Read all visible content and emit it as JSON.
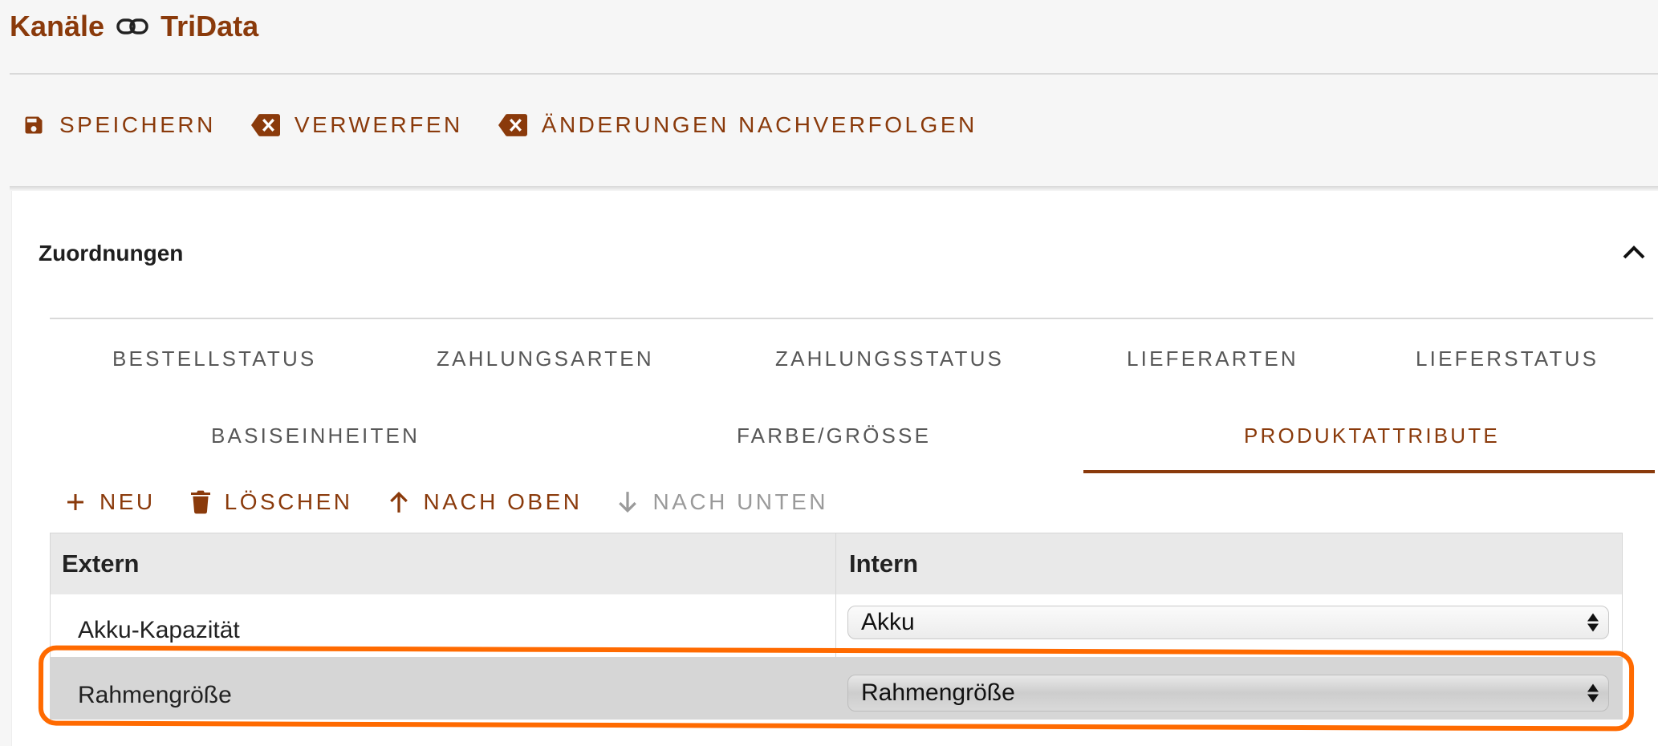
{
  "header": {
    "title_left": "Kanäle",
    "title_right": "TriData",
    "link_icon": "link-icon"
  },
  "toolbar": {
    "save": "SPEICHERN",
    "discard": "VERWERFEN",
    "track": "ÄNDERUNGEN NACHVERFOLGEN"
  },
  "section": {
    "title": "Zuordnungen",
    "collapse_icon": "chevron-up-icon"
  },
  "tabs": {
    "row1": [
      "BESTELLSTATUS",
      "ZAHLUNGSARTEN",
      "ZAHLUNGSSTATUS",
      "LIEFERARTEN",
      "LIEFERSTATUS"
    ],
    "row2": [
      "BASISEINHEITEN",
      "FARBE/GRÖSSE",
      "PRODUKTATTRIBUTE"
    ],
    "active": "PRODUKTATTRIBUTE"
  },
  "grid_toolbar": {
    "new": "NEU",
    "delete": "LÖSCHEN",
    "up": "NACH OBEN",
    "down": "NACH UNTEN"
  },
  "table": {
    "columns": [
      "Extern",
      "Intern"
    ],
    "rows": [
      {
        "extern": "Akku-Kapazität",
        "intern": "Akku"
      },
      {
        "extern": "Rahmengröße",
        "intern": "Rahmengröße"
      }
    ],
    "selected_row": 1
  },
  "colors": {
    "brand": "#8a3a0b",
    "highlight": "#ff6a00"
  }
}
